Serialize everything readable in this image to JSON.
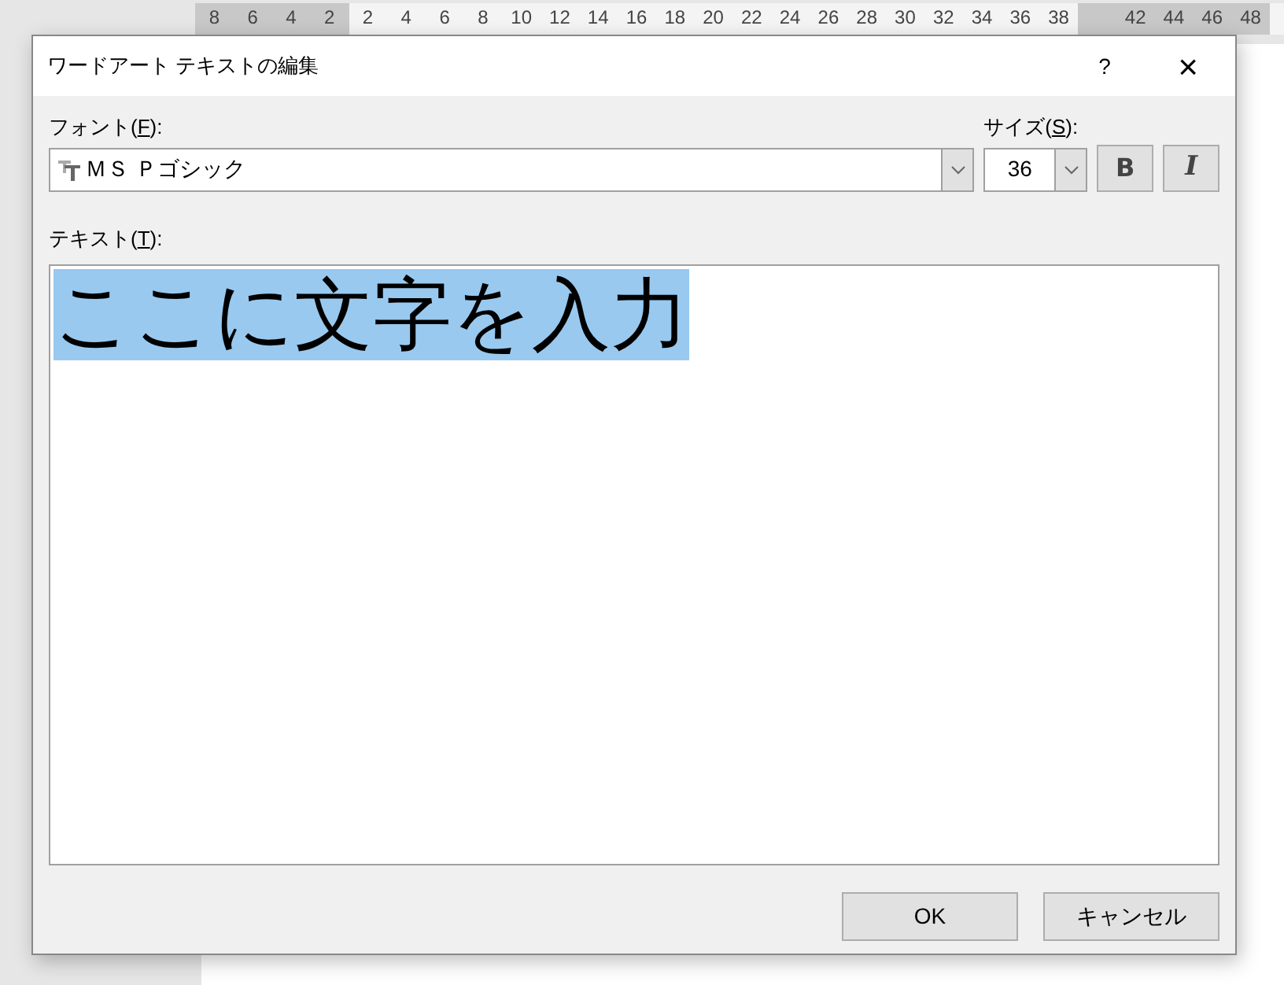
{
  "ruler": {
    "labels": [
      "8",
      "6",
      "4",
      "2",
      "2",
      "4",
      "6",
      "8",
      "10",
      "12",
      "14",
      "16",
      "18",
      "20",
      "22",
      "24",
      "26",
      "28",
      "30",
      "32",
      "34",
      "36",
      "38"
    ],
    "right_labels": [
      "42",
      "44",
      "46",
      "48"
    ]
  },
  "window": {
    "title": "ワードアート テキストの編集",
    "help": "?",
    "close": "×"
  },
  "font": {
    "label_before": "フォント(",
    "access_key": "F",
    "label_after": "):",
    "value": "ＭＳ Ｐゴシック"
  },
  "size": {
    "label_before": "サイズ(",
    "access_key": "S",
    "label_after": "):",
    "value": "36"
  },
  "bold": {
    "label": "B",
    "on": false
  },
  "italic": {
    "label": "I",
    "on": false
  },
  "text": {
    "label_before": "テキスト(",
    "access_key": "T",
    "label_after": "):",
    "value": "ここに文字を入力",
    "selected": true
  },
  "buttons": [
    "OK",
    "キャンセル"
  ]
}
